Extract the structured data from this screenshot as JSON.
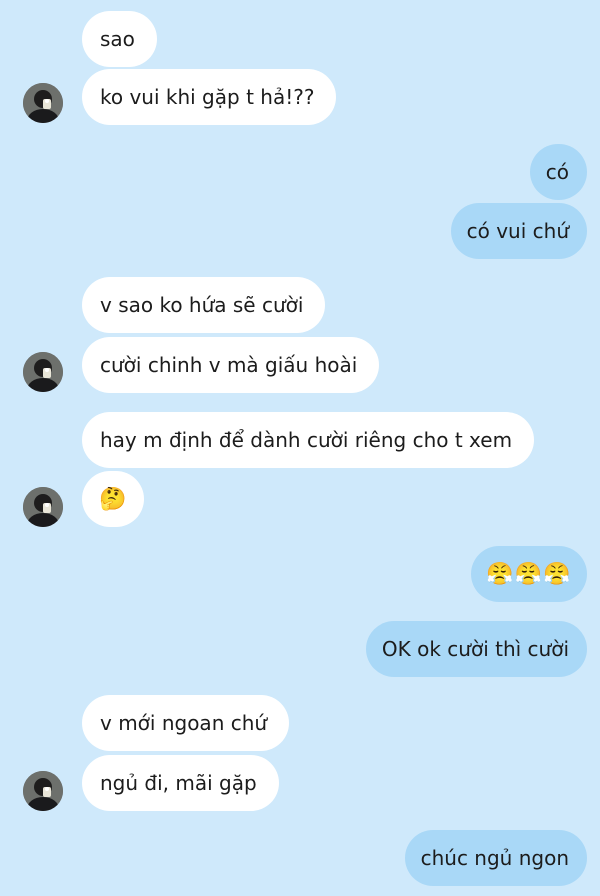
{
  "conversation": {
    "messages": [
      {
        "text": "sao",
        "sender": "other"
      },
      {
        "text": "ko vui khi gặp t hả!??",
        "sender": "other"
      },
      {
        "text": "có",
        "sender": "me"
      },
      {
        "text": "có vui chứ",
        "sender": "me"
      },
      {
        "text": "v sao ko hứa sẽ cười",
        "sender": "other"
      },
      {
        "text": "cười chinh v mà giấu hoài",
        "sender": "other"
      },
      {
        "text": "hay m định để dành cười riêng cho t xem",
        "sender": "other"
      },
      {
        "text": "🤔",
        "sender": "other"
      },
      {
        "text": "😤😤😤",
        "sender": "me"
      },
      {
        "text": "OK ok cười thì cười",
        "sender": "me"
      },
      {
        "text": "v mới ngoan chứ",
        "sender": "other"
      },
      {
        "text": "ngủ đi, mãi gặp",
        "sender": "other"
      },
      {
        "text": "chúc ngủ ngon",
        "sender": "me"
      }
    ]
  },
  "colors": {
    "background": "#cfe9fb",
    "incoming_bubble": "#ffffff",
    "outgoing_bubble": "#a9d8f7"
  },
  "icons": {
    "avatar": "contact-avatar-photo"
  }
}
